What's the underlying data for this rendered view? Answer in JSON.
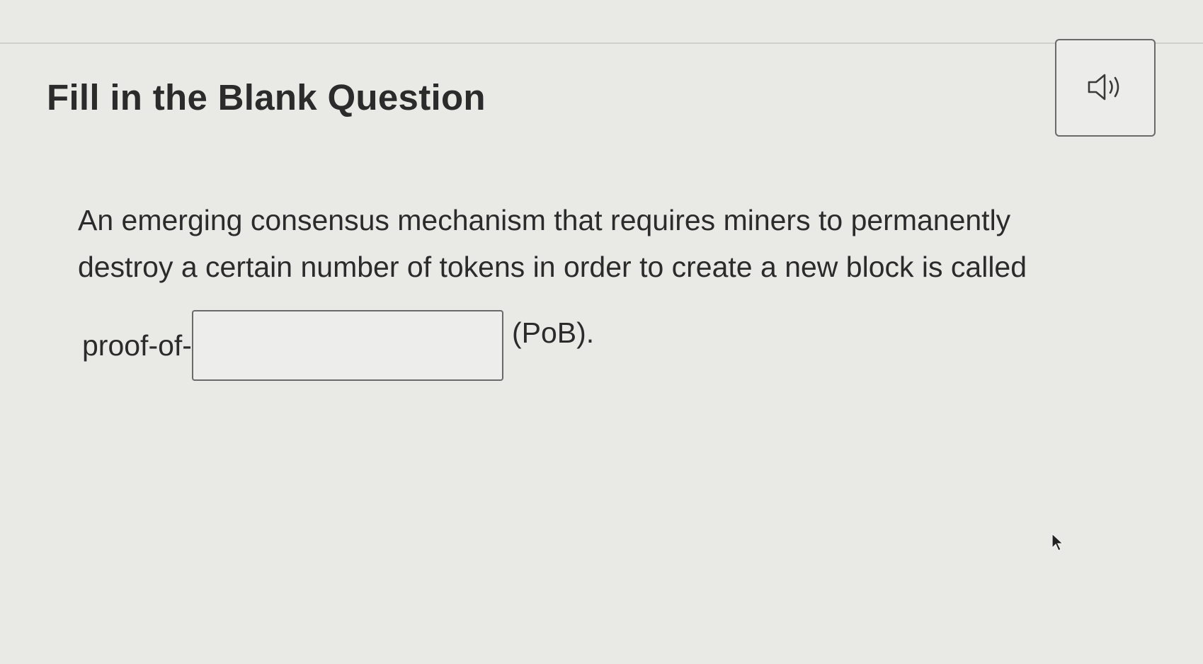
{
  "question": {
    "title": "Fill in the Blank Question",
    "body_lines": [
      "An emerging consensus mechanism that requires miners to permanently",
      "destroy a certain number of tokens in order to create a new block is called"
    ],
    "blank_prefix": "proof-of-",
    "blank_value": "",
    "blank_suffix": "(PoB)."
  },
  "audio_button": {
    "icon": "speaker-icon"
  }
}
